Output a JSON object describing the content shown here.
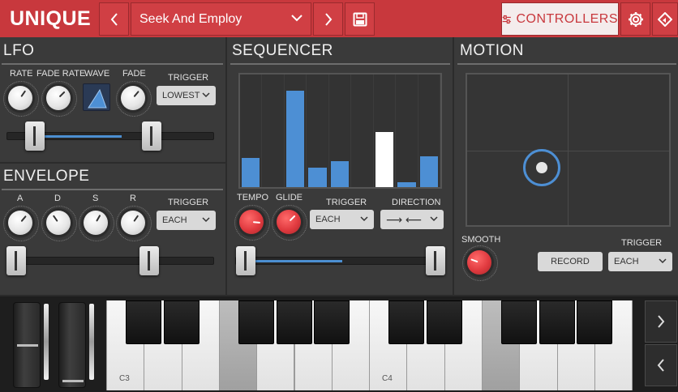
{
  "header": {
    "logo": "UNIQUE",
    "preset_name": "Seek And Employ",
    "controllers_label": "CONTROLLERS",
    "icons": [
      "chevron-left-icon",
      "chevron-down-icon",
      "chevron-right-icon",
      "save-icon",
      "sliders-icon",
      "gear-icon",
      "navigator-icon"
    ],
    "accent_color": "#c8383d"
  },
  "lfo": {
    "title": "LFO",
    "rate_label": "RATE",
    "fade_rate_label": "FADE RATE",
    "wave_label": "WAVE",
    "fade_label": "FADE",
    "trigger_label": "TRIGGER",
    "trigger_value": "LOWEST"
  },
  "envelope": {
    "title": "ENVELOPE",
    "a_label": "A",
    "d_label": "D",
    "s_label": "S",
    "r_label": "R",
    "trigger_label": "TRIGGER",
    "trigger_value": "EACH"
  },
  "sequencer": {
    "title": "SEQUENCER",
    "steps": [
      0.3,
      0.0,
      1.0,
      0.2,
      0.27,
      0.0,
      0.57,
      0.05,
      0.32
    ],
    "active_step": 6,
    "tempo_label": "TEMPO",
    "glide_label": "GLIDE",
    "trigger_label": "TRIGGER",
    "trigger_value": "EACH",
    "direction_label": "DIRECTION",
    "direction_value": "⟶ ⟵",
    "bar_color": "#4d8fd4"
  },
  "motion": {
    "title": "MOTION",
    "smooth_label": "SMOOTH",
    "record_label": "RECORD",
    "trigger_label": "TRIGGER",
    "trigger_value": "EACH"
  },
  "keyboard": {
    "c3_label": "C3",
    "c4_label": "C4"
  }
}
